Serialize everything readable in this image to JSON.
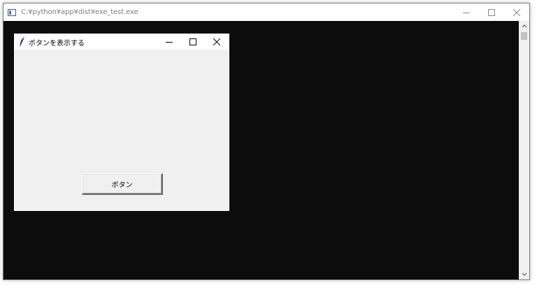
{
  "console": {
    "title": "C:¥python¥app¥dist¥exe_test.exe",
    "icon": "console-app-icon",
    "background": "#0c0c0c"
  },
  "tk_window": {
    "title": "ボタンを表示する",
    "icon": "feather-icon",
    "button_label": "ボタン",
    "background": "#f0f0f0"
  },
  "controls": {
    "minimize": "minimize-icon",
    "maximize": "maximize-icon",
    "close": "close-icon"
  }
}
